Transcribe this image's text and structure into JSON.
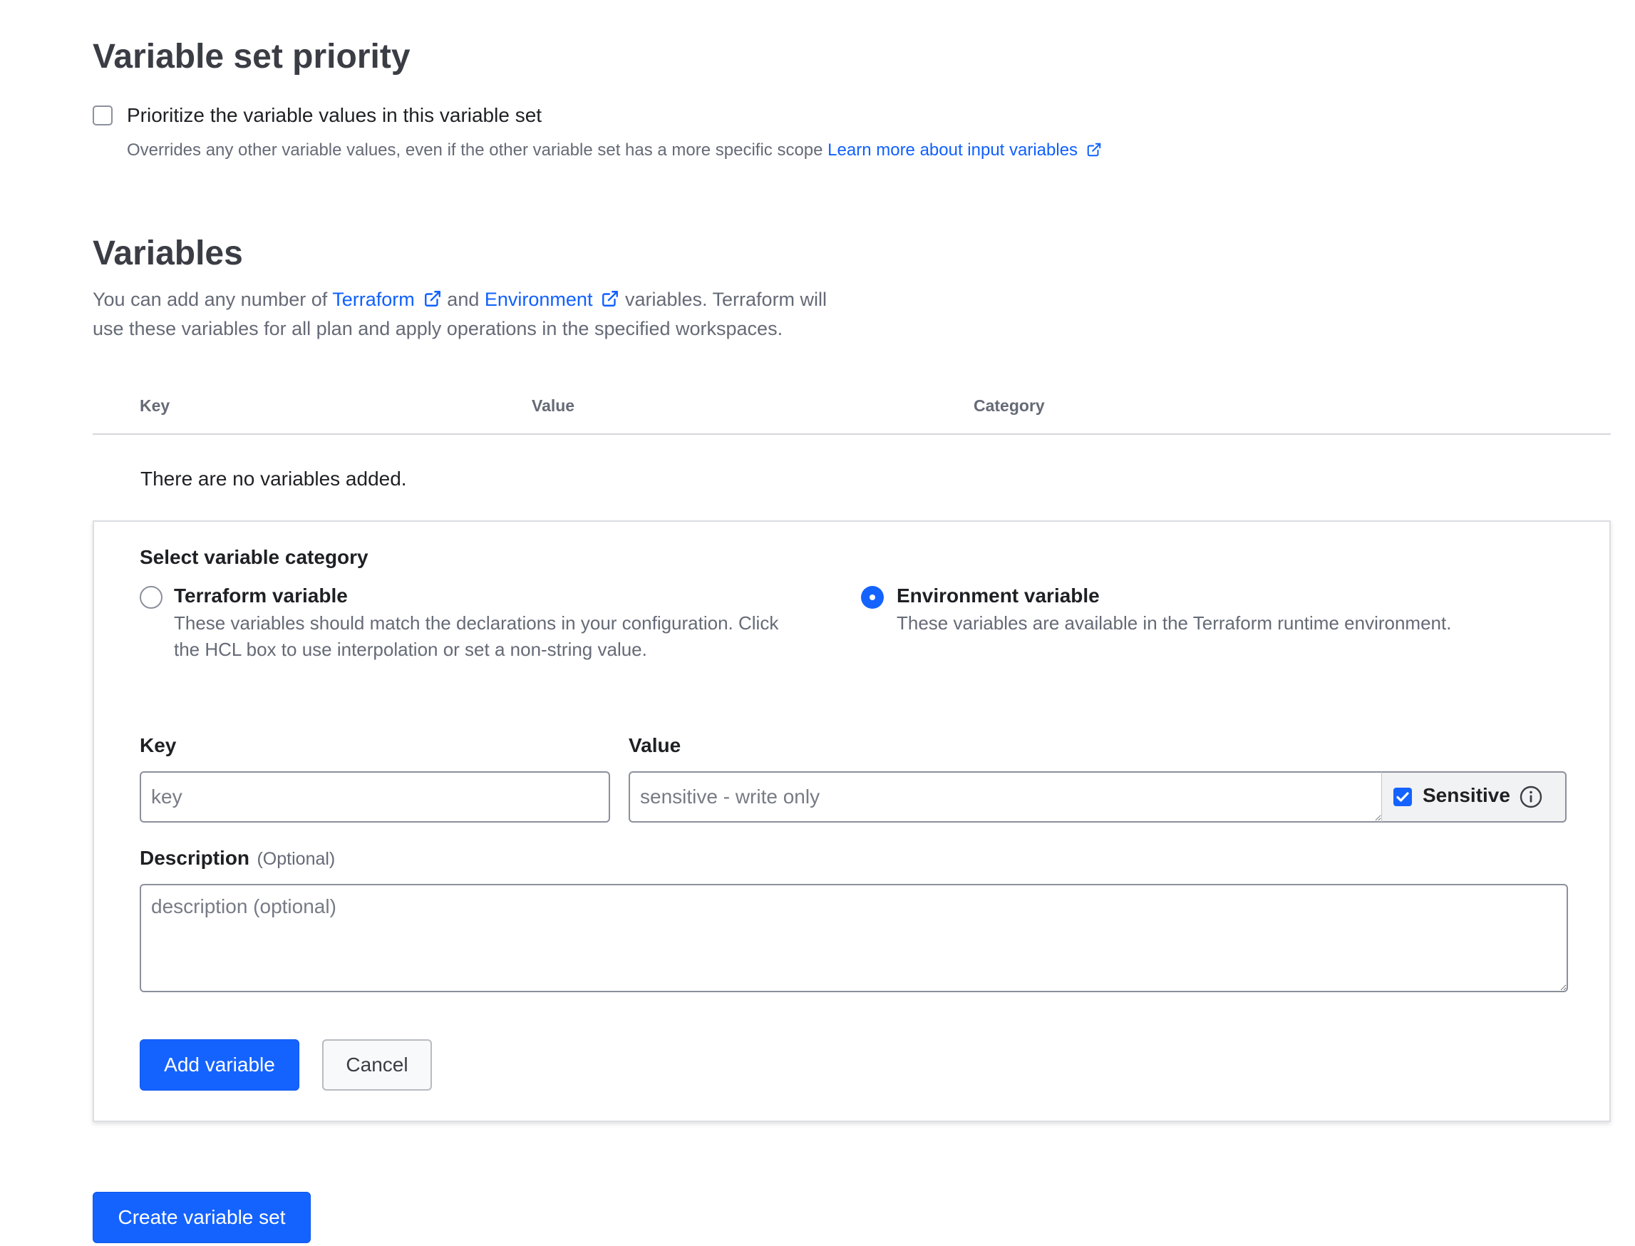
{
  "priority": {
    "title": "Variable set priority",
    "checkbox_label": "Prioritize the variable values in this variable set",
    "help_text": "Overrides any other variable values, even if the other variable set has a more specific scope",
    "learn_more_link": "Learn more about input variables",
    "checked": false
  },
  "variables": {
    "title": "Variables",
    "intro_part1": "You can add any number of",
    "terraform_link": "Terraform",
    "intro_and": "and",
    "environment_link": "Environment",
    "intro_part2": "variables. Terraform will",
    "intro_line2": "use these variables for all plan and apply operations in the specified workspaces.",
    "table_headers": [
      "Key",
      "Value",
      "Category"
    ],
    "empty_message": "There are no variables added."
  },
  "form": {
    "category_title": "Select variable category",
    "categories": [
      {
        "label": "Terraform variable",
        "help_line1": "These variables should match the declarations in your configuration. Click",
        "help_line2": "the HCL box to use interpolation or set a non-string value.",
        "selected": false
      },
      {
        "label": "Environment variable",
        "help_line1": "These variables are available in the Terraform runtime environment.",
        "selected": true
      }
    ],
    "key_label": "Key",
    "key_placeholder": "key",
    "value_label": "Value",
    "value_placeholder": "sensitive - write only",
    "sensitive_label": "Sensitive",
    "sensitive_checked": true,
    "description_label": "Description",
    "description_optional": "(Optional)",
    "description_placeholder": "description (optional)",
    "add_button": "Add variable",
    "cancel_button": "Cancel"
  },
  "create_button": "Create variable set",
  "colors": {
    "accent": "#1563ff",
    "link": "#1060ff",
    "heading": "#3b3d45",
    "muted": "#656a76"
  }
}
